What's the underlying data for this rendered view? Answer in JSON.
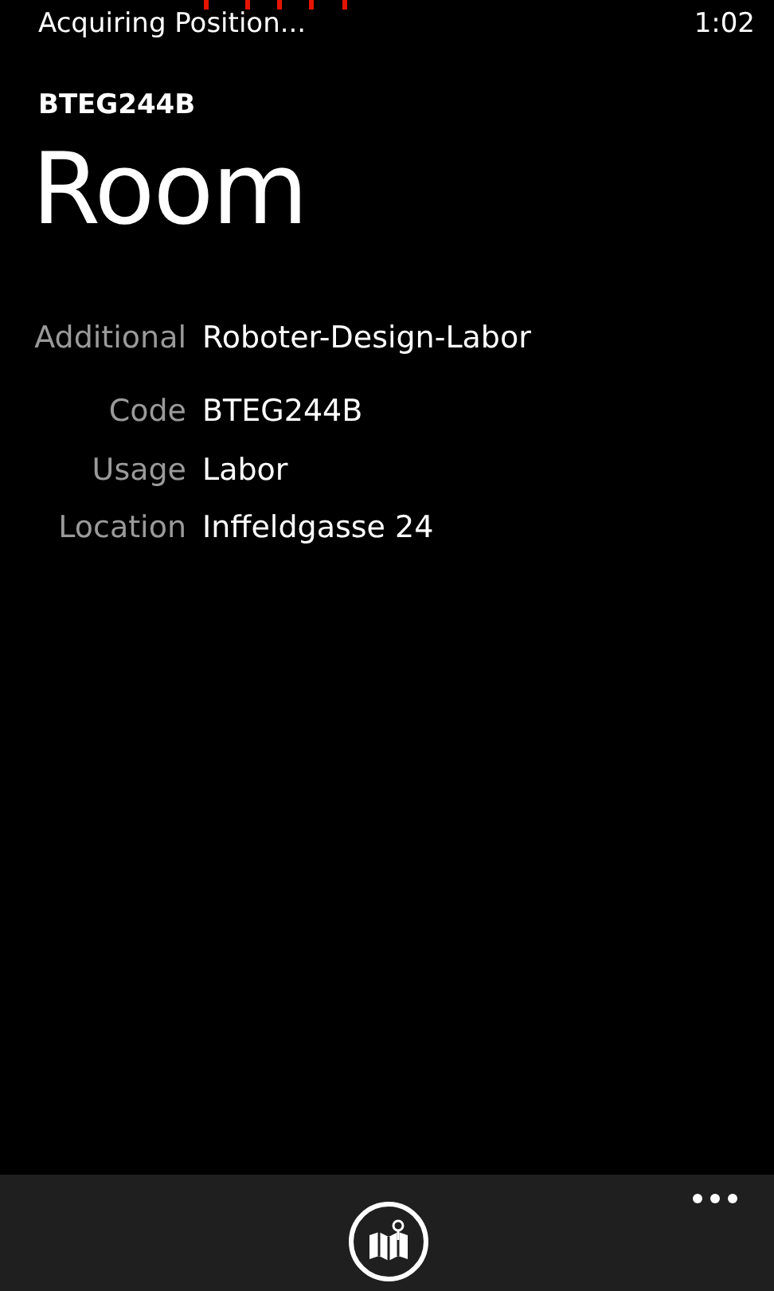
{
  "status_bar": {
    "text": "Acquiring Position...",
    "time": "1:02"
  },
  "app_title": "BTEG244B",
  "page_title": "Room",
  "details": [
    {
      "label": "Additional",
      "value": "Roboter-Design-Labor"
    },
    {
      "label": "Code",
      "value": "BTEG244B"
    },
    {
      "label": "Usage",
      "value": "Labor"
    },
    {
      "label": "Location",
      "value": "Inffeldgasse 24"
    }
  ]
}
